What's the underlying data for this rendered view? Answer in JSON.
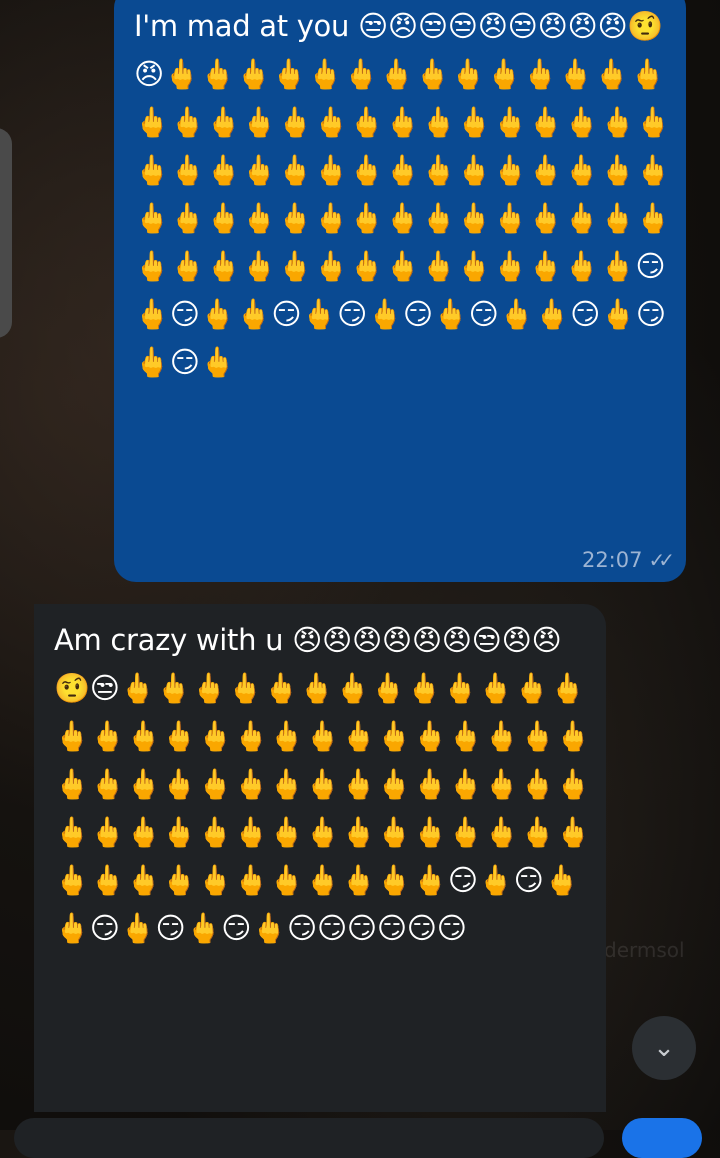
{
  "messages": [
    {
      "direction": "outgoing",
      "text": "I'm mad at you 😒😠😒😒😠😒😠😠😠🤨😠🖕🖕🖕🖕🖕🖕🖕🖕🖕🖕🖕🖕🖕🖕🖕🖕🖕🖕🖕🖕🖕🖕🖕🖕🖕🖕🖕🖕🖕🖕🖕🖕🖕🖕🖕🖕🖕🖕🖕🖕🖕🖕🖕🖕🖕🖕🖕🖕🖕🖕🖕🖕🖕🖕🖕🖕🖕🖕🖕🖕🖕🖕🖕🖕🖕🖕🖕🖕🖕🖕🖕🖕🖕😏🖕😏🖕🖕😏🖕😏🖕😏🖕😏🖕🖕😏🖕😏🖕😏🖕",
      "time": "22:07",
      "status_icon": "double-check-read-icon"
    },
    {
      "direction": "incoming",
      "text": "Am crazy with u 😠😠😠😠😠😠😒😠😠🤨😒🖕🖕🖕🖕🖕🖕🖕🖕🖕🖕🖕🖕🖕🖕🖕🖕🖕🖕🖕🖕🖕🖕🖕🖕🖕🖕🖕🖕🖕🖕🖕🖕🖕🖕🖕🖕🖕🖕🖕🖕🖕🖕🖕🖕🖕🖕🖕🖕🖕🖕🖕🖕🖕🖕🖕🖕🖕🖕🖕🖕🖕🖕🖕🖕🖕🖕🖕🖕🖕😏🖕😏🖕🖕😏🖕😏🖕😏🖕😏😏😏😏😏😏"
    }
  ],
  "watermark": "dermsol",
  "scroll_button": {
    "icon": "double-chevron-down-icon"
  },
  "colors": {
    "outgoing_bubble": "#0a4a92",
    "incoming_bubble": "#1f2225"
  }
}
